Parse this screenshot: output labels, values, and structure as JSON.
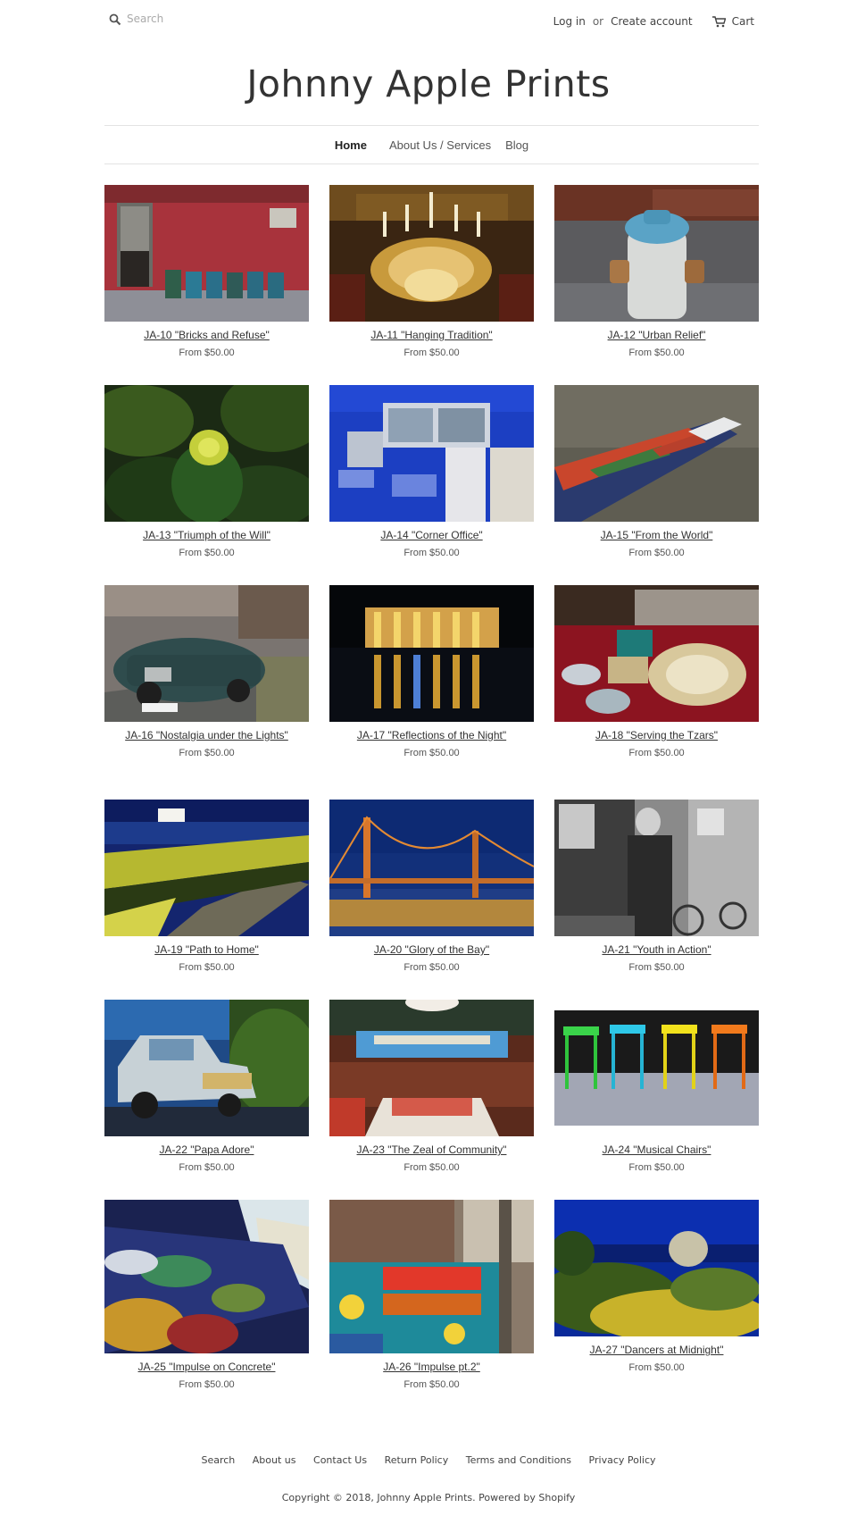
{
  "header": {
    "search_placeholder": "Search",
    "login_label": "Log in",
    "or_label": "or",
    "create_account_label": "Create account",
    "cart_label": "Cart"
  },
  "site_title": "Johnny Apple Prints",
  "nav": {
    "items": [
      {
        "label": "Home",
        "active": true
      },
      {
        "label": "About Us / Services"
      },
      {
        "label": "Blog"
      }
    ]
  },
  "products": [
    {
      "name": "JA-10 \"Bricks and Refuse\"",
      "price": "From $50.00",
      "image": "brick-wall-trash-cans"
    },
    {
      "name": "JA-11 \"Hanging Tradition\"",
      "price": "From $50.00",
      "image": "chandelier"
    },
    {
      "name": "JA-12 \"Urban Relief\"",
      "price": "From $50.00",
      "image": "fire-hydrant"
    },
    {
      "name": "JA-13 \"Triumph of the Will\"",
      "price": "From $50.00",
      "image": "green-plant"
    },
    {
      "name": "JA-14 \"Corner Office\"",
      "price": "From $50.00",
      "image": "blue-graffiti-building"
    },
    {
      "name": "JA-15 \"From the World\"",
      "price": "From $50.00",
      "image": "container-ship"
    },
    {
      "name": "JA-16 \"Nostalgia under the Lights\"",
      "price": "From $50.00",
      "image": "vintage-car"
    },
    {
      "name": "JA-17 \"Reflections of the Night\"",
      "price": "From $50.00",
      "image": "night-reflection"
    },
    {
      "name": "JA-18 \"Serving the Tzars\"",
      "price": "From $50.00",
      "image": "antique-tableware"
    },
    {
      "name": "JA-19 \"Path to Home\"",
      "price": "From $50.00",
      "image": "boardwalk-night"
    },
    {
      "name": "JA-20 \"Glory of the Bay\"",
      "price": "From $50.00",
      "image": "golden-gate-bridge"
    },
    {
      "name": "JA-21 \"Youth in Action\"",
      "price": "From $50.00",
      "image": "street-portrait-bw"
    },
    {
      "name": "JA-22 \"Papa Adore\"",
      "price": "From $50.00",
      "image": "vintage-truck"
    },
    {
      "name": "JA-23 \"The Zeal of Community\"",
      "price": "From $50.00",
      "image": "restaurant-interior"
    },
    {
      "name": "JA-24 \"Musical Chairs\"",
      "price": "From $50.00",
      "image": "colorful-stools"
    },
    {
      "name": "JA-25 \"Impulse on Concrete\"",
      "price": "From $50.00",
      "image": "graffiti-wall"
    },
    {
      "name": "JA-26 \"Impulse pt.2\"",
      "price": "From $50.00",
      "image": "climate-change-mural"
    },
    {
      "name": "JA-27 \"Dancers at Midnight\"",
      "price": "From $50.00",
      "image": "garden-sculpture"
    }
  ],
  "footer": {
    "links": [
      "Search",
      "About us",
      "Contact Us",
      "Return Policy",
      "Terms and Conditions",
      "Privacy Policy"
    ],
    "copyright": "Copyright © 2018, Johnny Apple Prints. Powered by Shopify"
  }
}
